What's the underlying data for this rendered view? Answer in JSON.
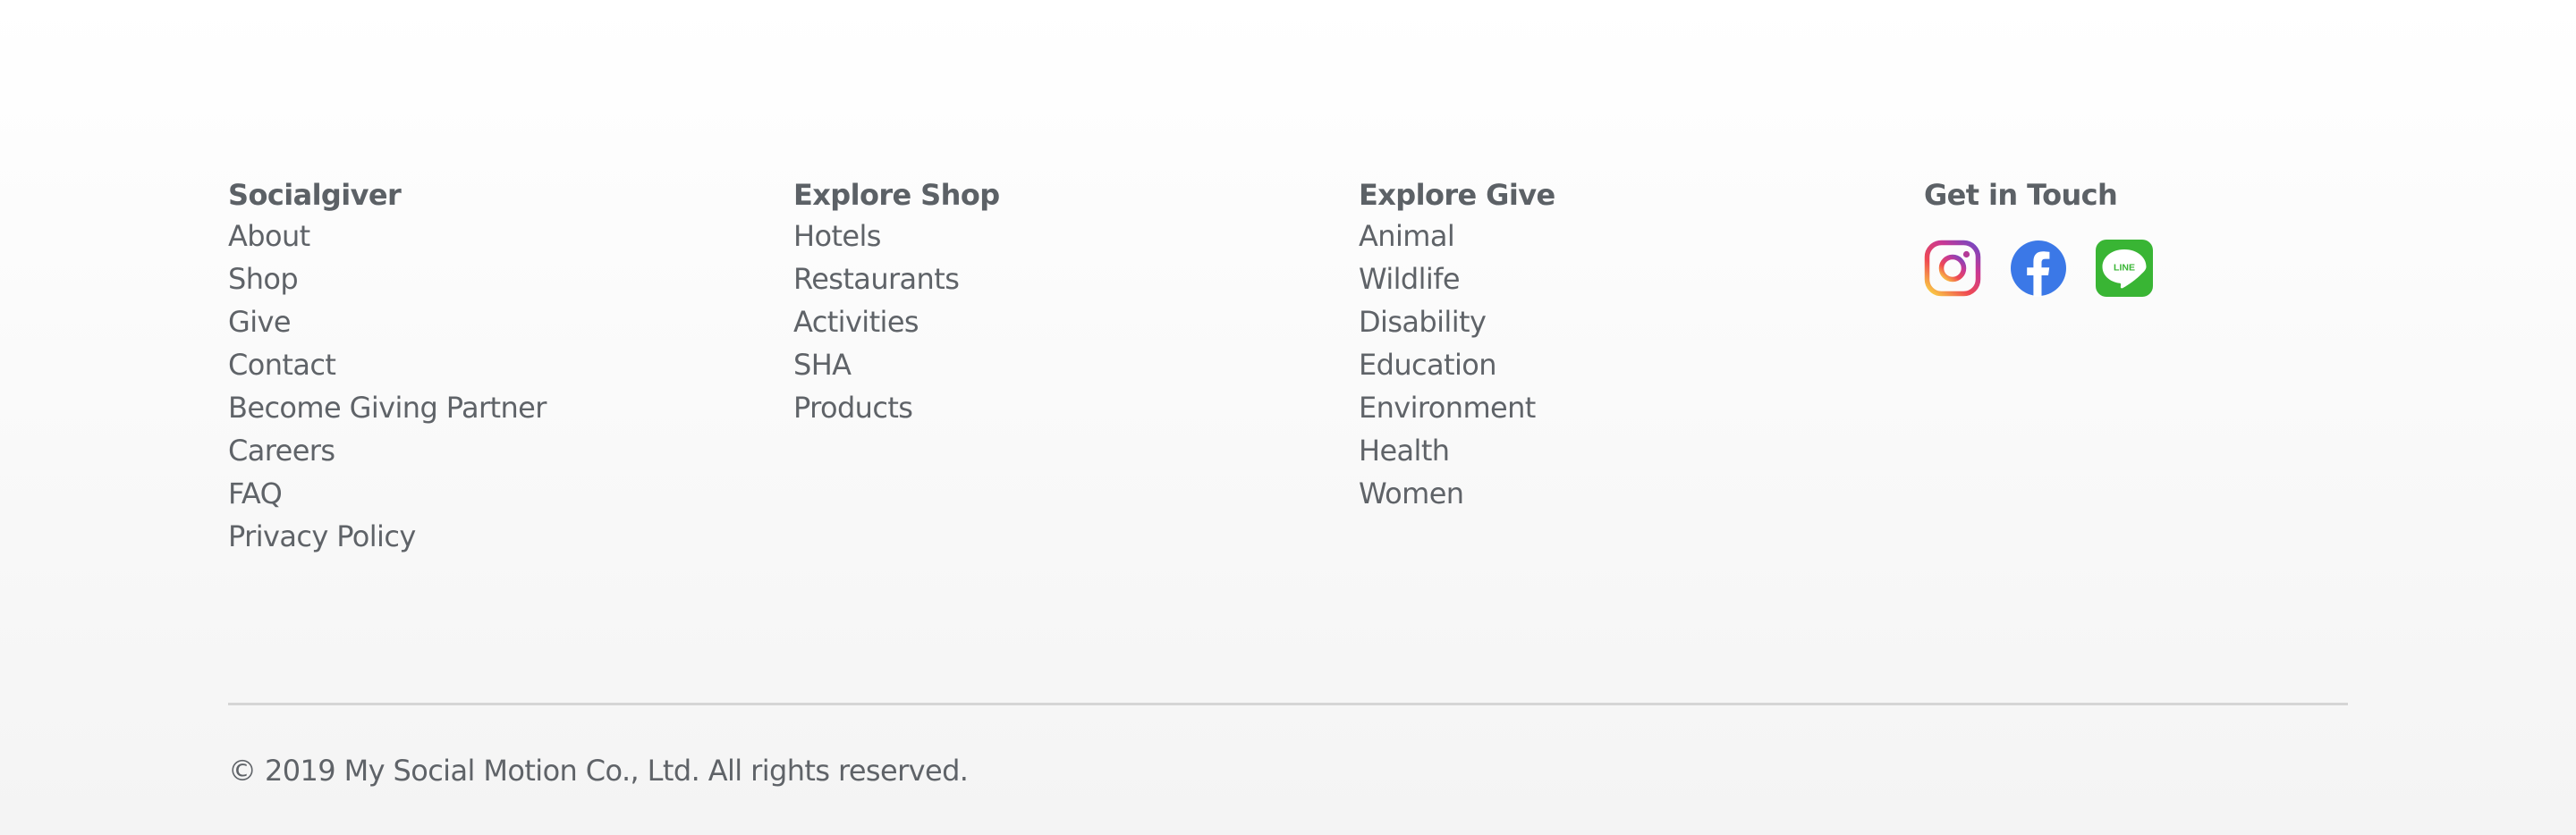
{
  "footer": {
    "columns": [
      {
        "heading": "Socialgiver",
        "links": [
          "About",
          "Shop",
          "Give",
          "Contact",
          "Become Giving Partner",
          "Careers",
          "FAQ",
          "Privacy Policy"
        ]
      },
      {
        "heading": "Explore Shop",
        "links": [
          "Hotels",
          "Restaurants",
          "Activities",
          "SHA",
          "Products"
        ]
      },
      {
        "heading": "Explore Give",
        "links": [
          "Animal",
          "Wildlife",
          "Disability",
          "Education",
          "Environment",
          "Health",
          "Women"
        ]
      }
    ],
    "contact": {
      "heading": "Get in Touch",
      "social": [
        {
          "icon": "instagram-icon"
        },
        {
          "icon": "facebook-icon",
          "color": "#3b78e7"
        },
        {
          "icon": "line-icon",
          "color": "#39b534",
          "text": "LINE"
        }
      ]
    },
    "copyright": "© 2019 My Social Motion Co., Ltd. All rights reserved."
  }
}
